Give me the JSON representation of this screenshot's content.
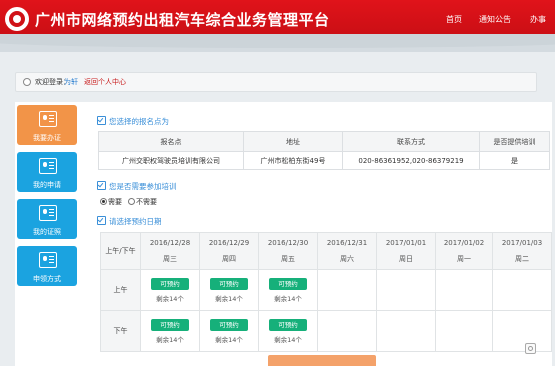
{
  "header": {
    "title": "广州市网络预约出租汽车综合业务管理平台",
    "nav": [
      "首页",
      "通知公告",
      "办事"
    ]
  },
  "welcome": {
    "label": "欢迎登录：",
    "user": "为轩",
    "link": "返回个人中心"
  },
  "sidebar": {
    "items": [
      {
        "label": "我要办证",
        "icon": "id-card-icon",
        "active": true
      },
      {
        "label": "我的申请",
        "icon": "id-card-icon",
        "active": false
      },
      {
        "label": "我的证照",
        "icon": "id-card-icon",
        "active": false
      },
      {
        "label": "申领方式",
        "icon": "id-card-icon",
        "active": false
      }
    ]
  },
  "sections": {
    "location_title": "您选择的报名点为",
    "training_title": "您是否需要参加培训",
    "date_title": "请选择预约日期"
  },
  "location_table": {
    "headers": [
      "报名点",
      "地址",
      "联系方式",
      "是否提供培训"
    ],
    "row": [
      "广州交职权驾驶员培训有限公司",
      "广州市松柏东街49号",
      "020-86361952,020-86379219",
      "是"
    ]
  },
  "training_options": [
    "需要",
    "不需要"
  ],
  "schedule": {
    "corner": "上午/下午",
    "columns": [
      {
        "date": "2016/12/28",
        "day": "周三"
      },
      {
        "date": "2016/12/29",
        "day": "周四"
      },
      {
        "date": "2016/12/30",
        "day": "周五"
      },
      {
        "date": "2016/12/31",
        "day": "周六"
      },
      {
        "date": "2017/01/01",
        "day": "周日"
      },
      {
        "date": "2017/01/02",
        "day": "周一"
      },
      {
        "date": "2017/01/03",
        "day": "周二"
      }
    ],
    "rows": [
      {
        "label": "上午",
        "slots": [
          "可预约",
          "可预约",
          "可预约",
          "",
          "",
          "",
          ""
        ],
        "remain": [
          "剩余14个",
          "剩余14个",
          "剩余14个",
          "",
          "",
          "",
          ""
        ]
      },
      {
        "label": "下午",
        "slots": [
          "可预约",
          "可预约",
          "可预约",
          "",
          "",
          "",
          ""
        ],
        "remain": [
          "剩余14个",
          "剩余14个",
          "剩余14个",
          "",
          "",
          "",
          ""
        ]
      }
    ]
  },
  "colors": {
    "header_red": "#d01218",
    "sidebar_blue": "#1ba3e0",
    "sidebar_active": "#f29448",
    "available_green": "#16b07a",
    "section_blue": "#3a8fd8"
  }
}
